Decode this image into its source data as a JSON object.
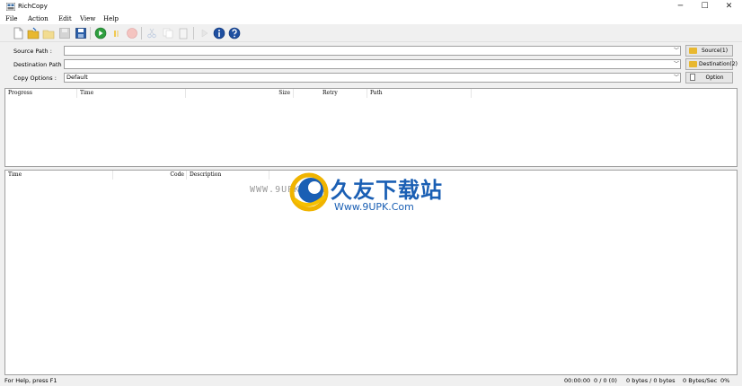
{
  "window": {
    "title": "RichCopy",
    "minimize": "─",
    "maximize": "☐",
    "close": "✕"
  },
  "menu": [
    "File",
    "Action",
    "Edit",
    "View",
    "Help"
  ],
  "toolbar_icons": [
    "new-icon",
    "open-icon",
    "open-list-icon",
    "save-disabled-icon",
    "save-icon",
    "start-icon",
    "pause-icon",
    "stop-icon",
    "cut-icon",
    "copy-icon",
    "paste-icon",
    "properties-icon",
    "info-icon",
    "help-icon"
  ],
  "form": {
    "source_label": "Source Path :",
    "source_value": "",
    "source_button": "Source(1)",
    "destination_label": "Destination Path :",
    "destination_value": "",
    "destination_button": "Destination(2)",
    "copy_options_label": "Copy Options :",
    "copy_options_value": "Default",
    "option_button": "Option"
  },
  "progress_table": {
    "columns": [
      "Progress",
      "Time",
      "Size",
      "Retry",
      "Path"
    ]
  },
  "log_table": {
    "columns": [
      "Time",
      "Code",
      "Description"
    ]
  },
  "watermark": {
    "small_text": "WWW.9UPK.COM",
    "chinese_text": "久友下载站",
    "url_text": "Www.9UPK.Com"
  },
  "status": {
    "help": "For Help, press F1",
    "elapsed": "00:00:00",
    "files": "0 / 0 (0)",
    "bytes": "0 bytes / 0 bytes",
    "rate": "0 Bytes/Sec",
    "percent": "0%"
  },
  "colors": {
    "accent_blue": "#1a5fb4",
    "folder": "#e8b830",
    "start_green": "#2e9e3e",
    "stop_red": "#d9342b"
  }
}
